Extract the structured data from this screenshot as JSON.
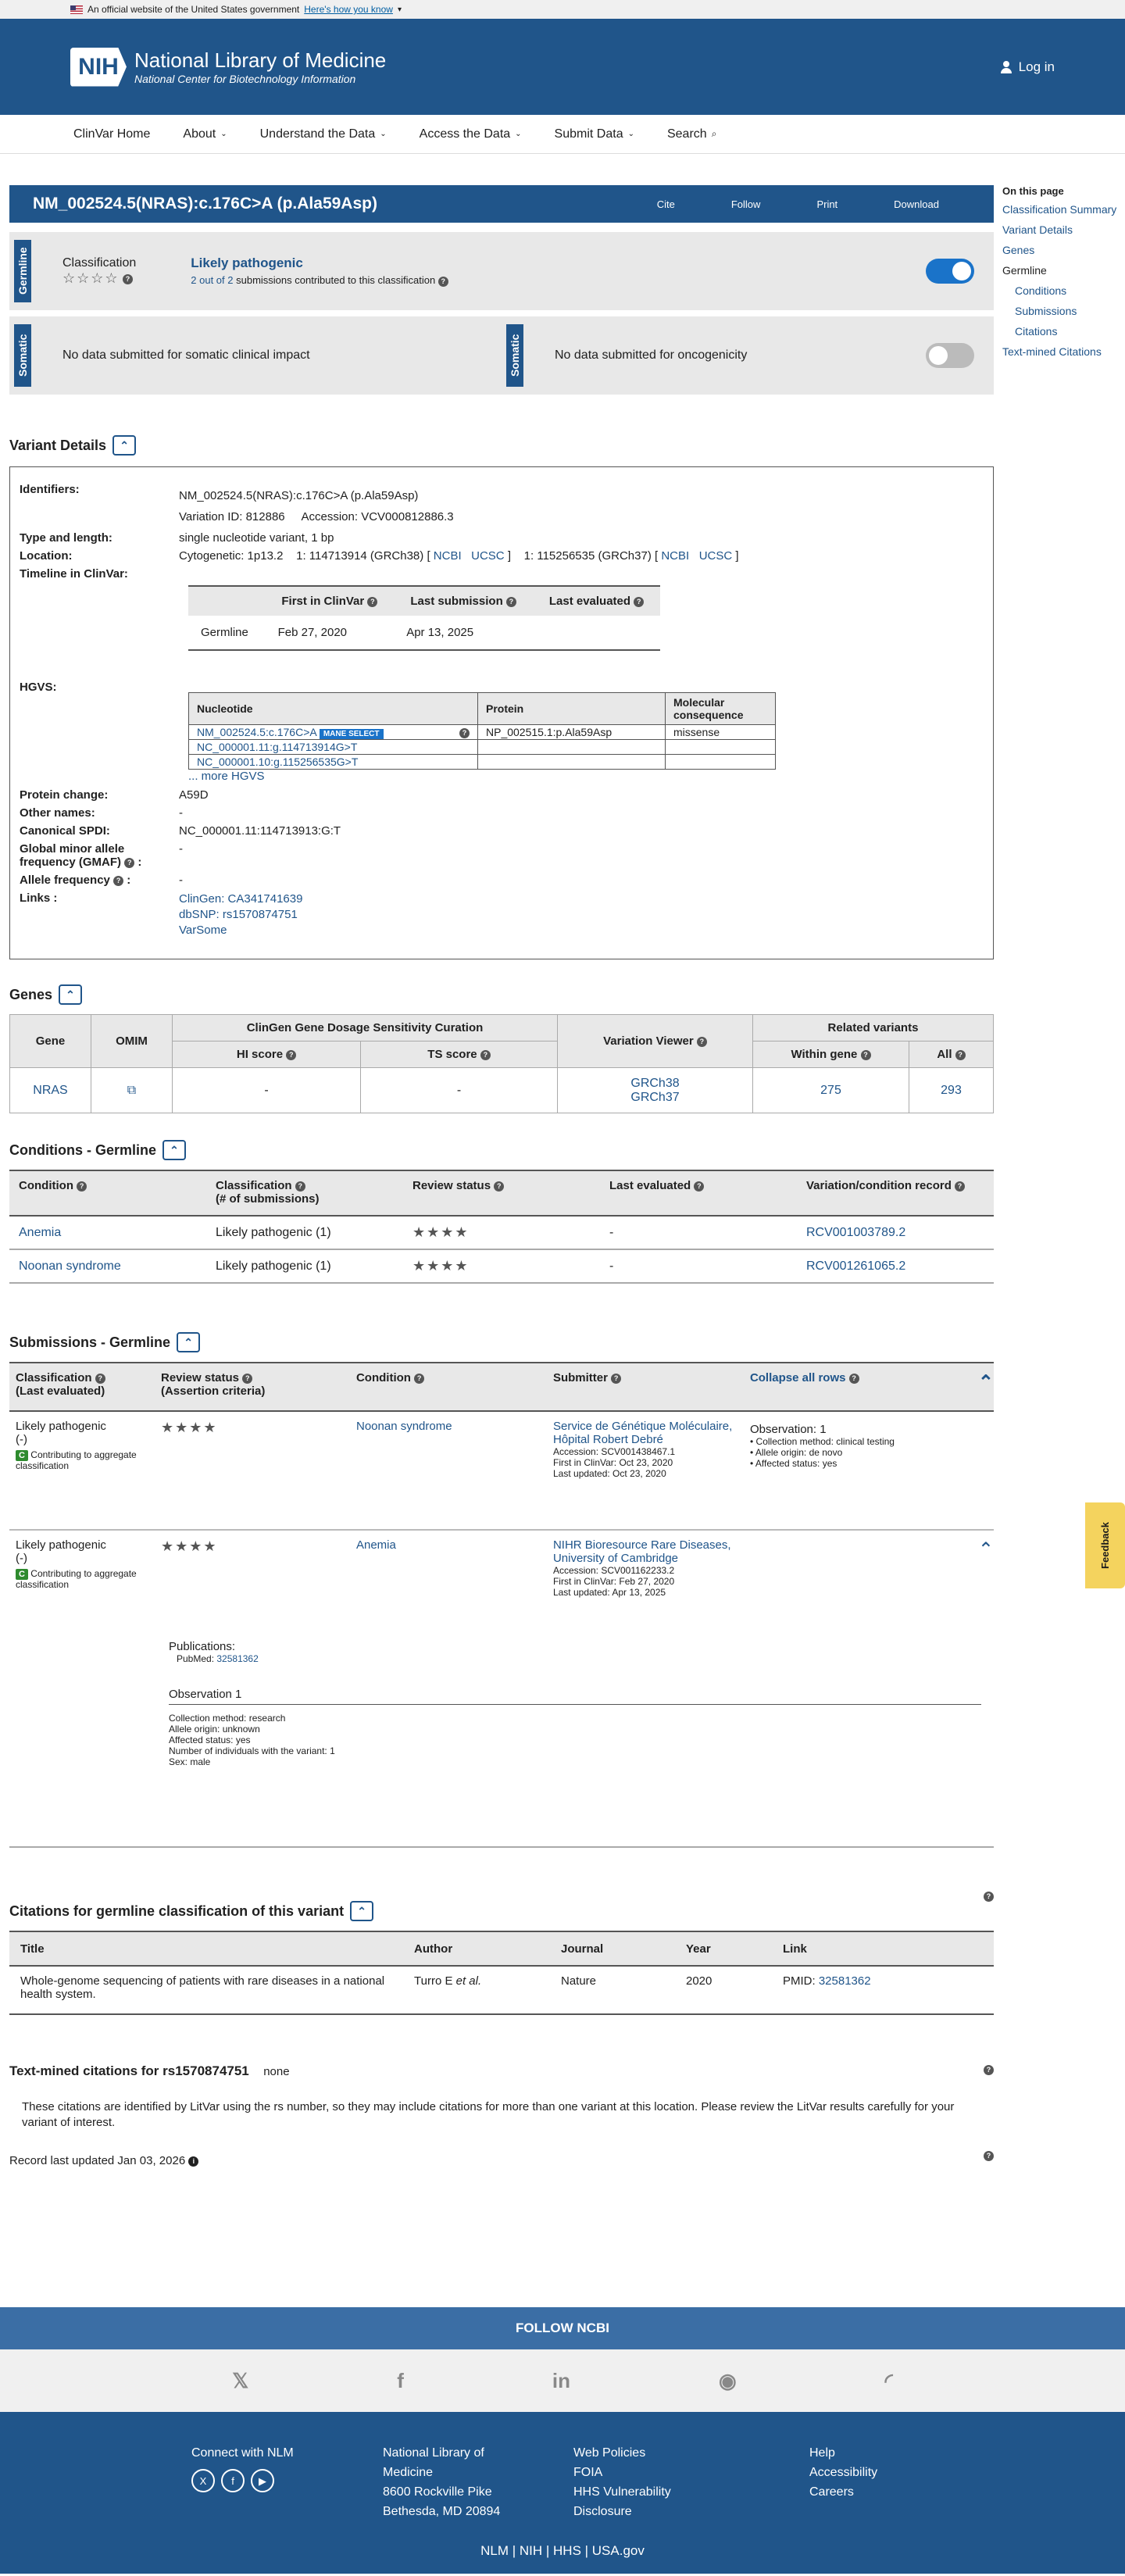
{
  "gov": {
    "text": "An official website of the United States government",
    "link": "Here's how you know"
  },
  "brand": {
    "logo": "NIH",
    "title": "National Library of Medicine",
    "subtitle": "National Center for Biotechnology Information",
    "login": "Log in"
  },
  "nav": [
    "ClinVar Home",
    "About",
    "Understand the Data",
    "Access the Data",
    "Submit Data",
    "Search"
  ],
  "title": "NM_002524.5(NRAS):c.176C>A (p.Ala59Asp)",
  "actions": [
    "Cite",
    "Follow",
    "Print",
    "Download"
  ],
  "toc": {
    "heading": "On this page",
    "items": [
      "Classification Summary",
      "Variant Details",
      "Genes",
      "Germline",
      "Conditions",
      "Submissions",
      "Citations",
      "Text-mined Citations"
    ]
  },
  "germline": {
    "tag": "Germline",
    "label": "Classification",
    "classification": "Likely pathogenic",
    "count": "2 out of 2",
    "count_suffix": "submissions contributed to this classification"
  },
  "somatic": {
    "tag": "Somatic",
    "left": "No data submitted for somatic clinical impact",
    "right": "No data submitted for oncogenicity"
  },
  "vd": {
    "heading": "Variant Details",
    "identifiers_k": "Identifiers:",
    "identifiers": "NM_002524.5(NRAS):c.176C>A (p.Ala59Asp)",
    "variation": "Variation ID: 812886",
    "accession": "Accession: VCV000812886.3",
    "type_k": "Type and length:",
    "type": "single nucleotide variant, 1 bp",
    "location_k": "Location:",
    "cyto": "Cytogenetic: 1p13.2",
    "grch38": "1: 114713914 (GRCh38) [",
    "grch37": "1: 115256535 (GRCh37) [",
    "ncbi": "NCBI",
    "ucsc": "UCSC",
    "close": "]",
    "timeline_k": "Timeline in ClinVar:",
    "timeline_head": [
      "",
      "First in ClinVar",
      "Last submission",
      "Last evaluated"
    ],
    "timeline_row": [
      "Germline",
      "Feb 27, 2020",
      "Apr 13, 2025",
      ""
    ],
    "hgvs_k": "HGVS:",
    "hgvs_head": [
      "Nucleotide",
      "Protein",
      "Molecular consequence"
    ],
    "hgvs_rows": [
      [
        "NM_002524.5:c.176C>A",
        "NP_002515.1:p.Ala59Asp",
        "missense"
      ],
      [
        "NC_000001.11:g.114713914G>T",
        "",
        ""
      ],
      [
        "NC_000001.10:g.115256535G>T",
        "",
        ""
      ]
    ],
    "mane": "MANE SELECT",
    "more": "... more HGVS",
    "protein_k": "Protein change:",
    "protein": "A59D",
    "other_k": "Other names:",
    "other": "-",
    "spdi_k": "Canonical SPDI:",
    "spdi": "NC_000001.11:114713913:G:T",
    "gmaf_k": "Global minor allele frequency (GMAF)",
    "gmaf": "-",
    "af_k": "Allele frequency",
    "af": "-",
    "links_k": "Links :",
    "links": [
      "ClinGen: CA341741639",
      "dbSNP: rs1570874751",
      "VarSome"
    ]
  },
  "genes": {
    "heading": "Genes",
    "h_gene": "Gene",
    "h_omim": "OMIM",
    "h_clingen": "ClinGen Gene Dosage Sensitivity Curation",
    "h_hi": "HI score",
    "h_ts": "TS score",
    "h_viewer": "Variation Viewer",
    "h_related": "Related variants",
    "h_within": "Within gene",
    "h_all": "All",
    "gene": "NRAS",
    "hi": "-",
    "ts": "-",
    "v1": "GRCh38",
    "v2": "GRCh37",
    "within": "275",
    "all": "293"
  },
  "conditions": {
    "heading": "Conditions - Germline",
    "head": [
      "Condition",
      "Classification",
      "(# of submissions)",
      "Review status",
      "Last evaluated",
      "Variation/condition record"
    ],
    "rows": [
      [
        "Anemia",
        "Likely pathogenic (1)",
        "-",
        "RCV001003789.2"
      ],
      [
        "Noonan syndrome",
        "Likely pathogenic (1)",
        "-",
        "RCV001261065.2"
      ]
    ]
  },
  "subs": {
    "heading": "Submissions - Germline",
    "head": [
      "Classification",
      "(Last evaluated)",
      "Review status",
      "(Assertion criteria)",
      "Condition",
      "Submitter",
      "Collapse all rows"
    ],
    "contrib": "Contributing to aggregate classification",
    "r1": {
      "cls": "Likely pathogenic",
      "dash": "(-)",
      "cond": "Noonan syndrome",
      "submitter": "Service de Génétique Moléculaire, Hôpital Robert Debré",
      "acc": "Accession: SCV001438467.1",
      "first": "First in ClinVar: Oct 23, 2020",
      "upd": "Last updated: Oct 23, 2020",
      "obs": "Observation: 1",
      "obs_items": [
        "Collection method: clinical testing",
        "Allele origin: de novo",
        "Affected status: yes"
      ]
    },
    "r2": {
      "cls": "Likely pathogenic",
      "dash": "(-)",
      "cond": "Anemia",
      "submitter": "NIHR Bioresource Rare Diseases, University of Cambridge",
      "acc": "Accession: SCV001162233.2",
      "first": "First in ClinVar: Feb 27, 2020",
      "upd": "Last updated: Apr 13, 2025",
      "pubs": "Publications:",
      "pubmed": "PubMed:",
      "pmid": "32581362",
      "obs_h": "Observation 1",
      "obs_items": [
        "Collection method: research",
        "Allele origin: unknown",
        "Affected status: yes",
        "Number of individuals with the variant: 1",
        "Sex: male"
      ]
    }
  },
  "citations": {
    "heading": "Citations for germline classification of this variant",
    "head": [
      "Title",
      "Author",
      "Journal",
      "Year",
      "Link"
    ],
    "title": "Whole-genome sequencing of patients with rare diseases in a national health system.",
    "author": "Turro E",
    "etal": "et al.",
    "journal": "Nature",
    "year": "2020",
    "pmid_label": "PMID:",
    "pmid": "32581362"
  },
  "textmined": {
    "heading": "Text-mined citations for rs1570874751",
    "none": "none",
    "desc": "These citations are identified by LitVar using the rs number, so they may include citations for more than one variant at this location. Please review the LitVar results carefully for your variant of interest."
  },
  "updated": "Record last updated Jan 03, 2026",
  "feedback": "Feedback",
  "footer": {
    "follow": "FOLLOW NCBI",
    "connect": "Connect with NLM",
    "address": [
      "National Library of",
      "Medicine",
      "8600 Rockville Pike",
      "Bethesda, MD 20894"
    ],
    "col3": [
      "Web Policies",
      "FOIA",
      "HHS Vulnerability",
      "Disclosure"
    ],
    "col4": [
      "Help",
      "Accessibility",
      "Careers"
    ],
    "bottom": "NLM | NIH | HHS | USA.gov"
  }
}
